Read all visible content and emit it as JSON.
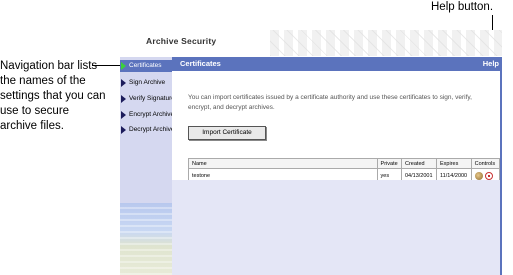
{
  "callouts": {
    "help": "Help button.",
    "navigation": [
      "Navigation bar lists",
      "the names of the",
      "settings that you can",
      "use to secure",
      "archive files."
    ]
  },
  "window": {
    "title": "Archive Security"
  },
  "header": {
    "title": "Certificates",
    "help_label": "Help"
  },
  "sidebar": {
    "items": [
      {
        "label": "Certificates",
        "active": true
      },
      {
        "label": "Sign Archive",
        "active": false
      },
      {
        "label": "Verify Signature",
        "active": false
      },
      {
        "label": "Encrypt Archive",
        "active": false
      },
      {
        "label": "Decrypt Archive",
        "active": false
      }
    ]
  },
  "main": {
    "description": "You can import certificates issued by a certificate authority and use these certificates to sign, verify, encrypt, and decrypt archives.",
    "import_button": "Import Certificate",
    "table": {
      "columns": [
        "Name",
        "Private",
        "Created",
        "Expires",
        "Controls"
      ],
      "rows": [
        {
          "name": "testone",
          "private": "yes",
          "created": "04/13/2001",
          "expires": "11/14/2000",
          "controls": [
            "view-icon",
            "delete-icon"
          ]
        }
      ]
    }
  },
  "colors": {
    "header_bar": "#5b73bd",
    "sidebar_bg": "#d5d8f0",
    "active_indicator": "#3ad03a"
  }
}
